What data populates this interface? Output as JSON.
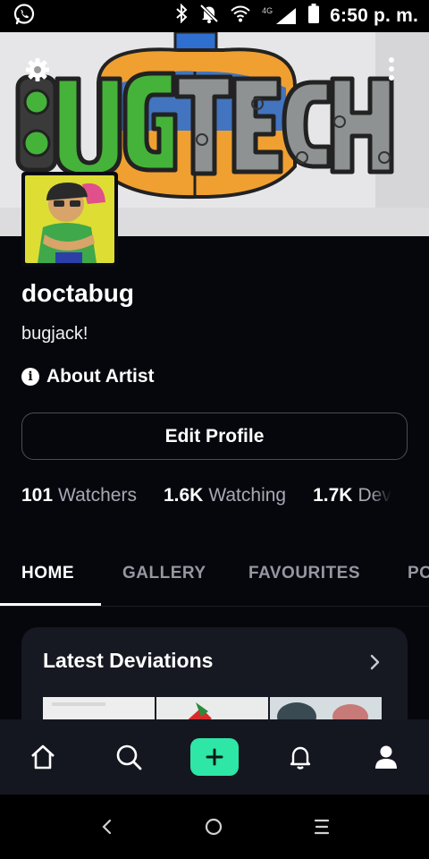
{
  "status_bar": {
    "time": "6:50 p. m.",
    "network_label": "4G",
    "icons": [
      "whatsapp-icon",
      "bluetooth-icon",
      "notifications-off-icon",
      "wifi-icon",
      "signal-icon",
      "battery-icon"
    ]
  },
  "banner": {
    "text": "BUGTECH",
    "icons": [
      "gear-icon",
      "more-vertical-icon"
    ]
  },
  "profile": {
    "username": "doctabug",
    "tagline": "bugjack!",
    "about_label": "About Artist",
    "about_icon": "info-icon",
    "edit_button": "Edit Profile"
  },
  "stats": [
    {
      "value": "101",
      "label": "Watchers"
    },
    {
      "value": "1.6K",
      "label": "Watching"
    },
    {
      "value": "1.7K",
      "label": "Dev"
    }
  ],
  "tabs": [
    "HOME",
    "GALLERY",
    "FAVOURITES",
    "PO"
  ],
  "active_tab": "HOME",
  "card": {
    "title": "Latest Deviations",
    "chevron_icon": "chevron-right-icon"
  },
  "bottom_nav": [
    "home-icon",
    "search-icon",
    "add-icon",
    "bell-icon",
    "profile-icon"
  ],
  "system_nav": [
    "back-icon",
    "home-circle-icon",
    "recents-icon"
  ],
  "colors": {
    "background": "#06070d",
    "card": "#161822",
    "nav": "#141620",
    "accent": "#2ee6a6",
    "muted": "#9597a1"
  }
}
